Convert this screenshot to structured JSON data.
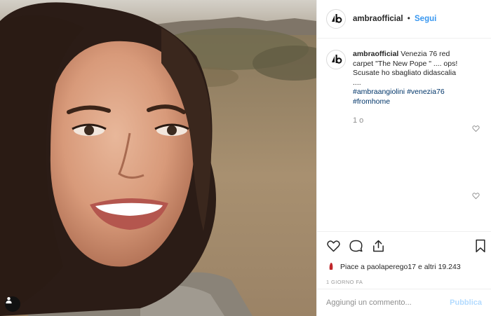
{
  "post": {
    "username": "ambraofficial",
    "separator": "•",
    "follow_label": "Segui",
    "caption": {
      "username": "ambraofficial",
      "text": "Venezia 76 red carpet \"The New Pope \" .... ops! Scusate ho sbagliato didascalia ....",
      "hashtags": [
        "#ambraangiolini",
        "#venezia76",
        "#fromhome"
      ]
    },
    "caption_meta": "1 o",
    "likes": {
      "prefix": "Piace a",
      "user": "paolaperego17",
      "suffix": "e altri",
      "count": "19.243"
    },
    "time_ago": "1 GIORNO FA",
    "comment": {
      "placeholder": "Aggiungi un commento...",
      "publish_label": "Pubblica"
    }
  },
  "colors": {
    "link": "#3897f0",
    "hashtag": "#003569",
    "border": "#efefef",
    "publish_disabled": "#b3dbff"
  },
  "icons": [
    "avatar-logo-icon",
    "heart-icon",
    "comment-icon",
    "share-icon",
    "bookmark-icon",
    "person-tag-icon",
    "small-heart-icon",
    "liker-avatar-icon"
  ]
}
